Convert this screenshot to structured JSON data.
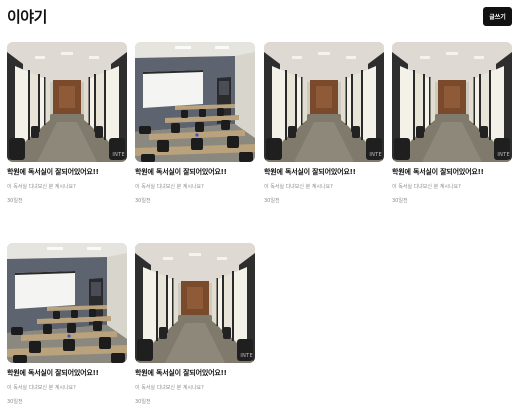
{
  "header": {
    "title": "이야기",
    "write_button": "글쓰기"
  },
  "posts": [
    {
      "title": "학원에 독서실이 잘되어있어요!!",
      "description": "이 독서실 디녀보신 분 계시나요?",
      "time": "30일전",
      "image": "study-room-booths",
      "watermark": "INTE"
    },
    {
      "title": "학원에 독서실이 잘되어있어요!!",
      "description": "이 독서실 디녀보신 분 계시나요?",
      "time": "30일전",
      "image": "classroom-projector",
      "watermark": ""
    },
    {
      "title": "학원에 독서실이 잘되어있어요!!",
      "description": "이 독서실 디녀보신 분 계시나요?",
      "time": "30일전",
      "image": "study-room-booths",
      "watermark": "INTE"
    },
    {
      "title": "학원에 독서실이 잘되어있어요!!",
      "description": "이 독서실 디녀보신 분 계시나요?",
      "time": "30일전",
      "image": "study-room-booths",
      "watermark": "INTE"
    },
    {
      "title": "학원에 독서실이 잘되어있어요!!",
      "description": "이 독서실 디녀보신 분 계시나요?",
      "time": "30일전",
      "image": "classroom-projector",
      "watermark": ""
    },
    {
      "title": "학원에 독서실이 잘되어있어요!!",
      "description": "이 독서실 디녀보신 분 계시나요?",
      "time": "30일전",
      "image": "study-room-booths",
      "watermark": "INTE"
    }
  ]
}
